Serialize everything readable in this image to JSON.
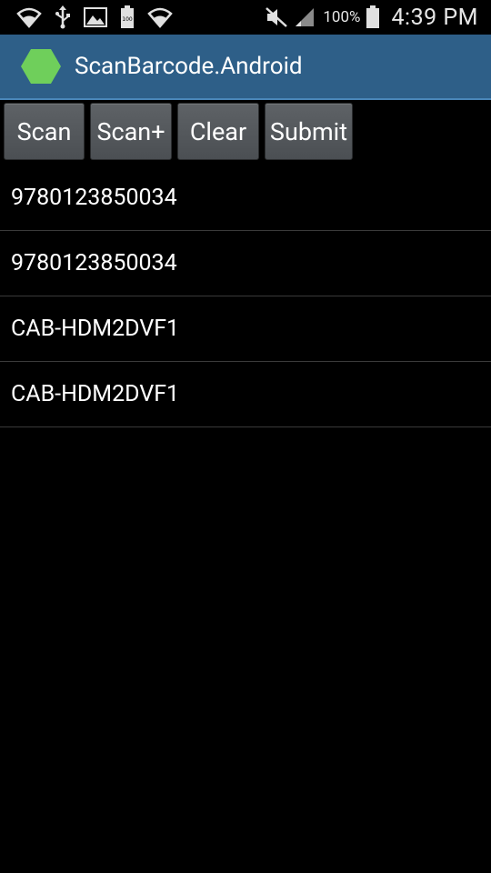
{
  "status_bar": {
    "battery_percent": "100%",
    "time": "4:39 PM",
    "icons": [
      "wifi-icon",
      "usb-icon",
      "image-icon",
      "battery-full-icon",
      "wifi-icon",
      "mute-icon",
      "signal-icon",
      "battery-icon"
    ]
  },
  "action_bar": {
    "title": "ScanBarcode.Android",
    "icon": "xamarin-hexagon-icon",
    "color": "#2e5f88"
  },
  "toolbar": {
    "scan_label": "Scan",
    "scan_plus_label": "Scan+",
    "clear_label": "Clear",
    "submit_label": "Submit"
  },
  "list": {
    "items": [
      "9780123850034",
      "9780123850034",
      "CAB-HDM2DVF1",
      "CAB-HDM2DVF1"
    ]
  }
}
